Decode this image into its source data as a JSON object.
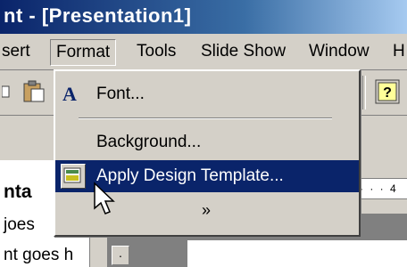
{
  "window": {
    "title": "nt - [Presentation1]"
  },
  "menubar": {
    "items": [
      {
        "label": "sert"
      },
      {
        "label": "Format"
      },
      {
        "label": "Tools"
      },
      {
        "label": "Slide Show"
      },
      {
        "label": "Window"
      },
      {
        "label": "H"
      }
    ]
  },
  "format_menu": {
    "items": [
      {
        "label": "Font...",
        "icon": "font-a-icon"
      },
      {
        "label": "Background..."
      },
      {
        "label": "Apply Design Template...",
        "icon": "design-template-icon",
        "highlighted": true
      }
    ],
    "expand_glyph": "»"
  },
  "outline": {
    "lines": [
      "nta",
      "joes",
      "nt goes h"
    ]
  },
  "ruler": {
    "text": "· · · 4"
  },
  "small_button": {
    "label": "·"
  },
  "colors": {
    "titlebar": "#0a246a",
    "highlight": "#0a246a",
    "face": "#d4d0c8"
  }
}
